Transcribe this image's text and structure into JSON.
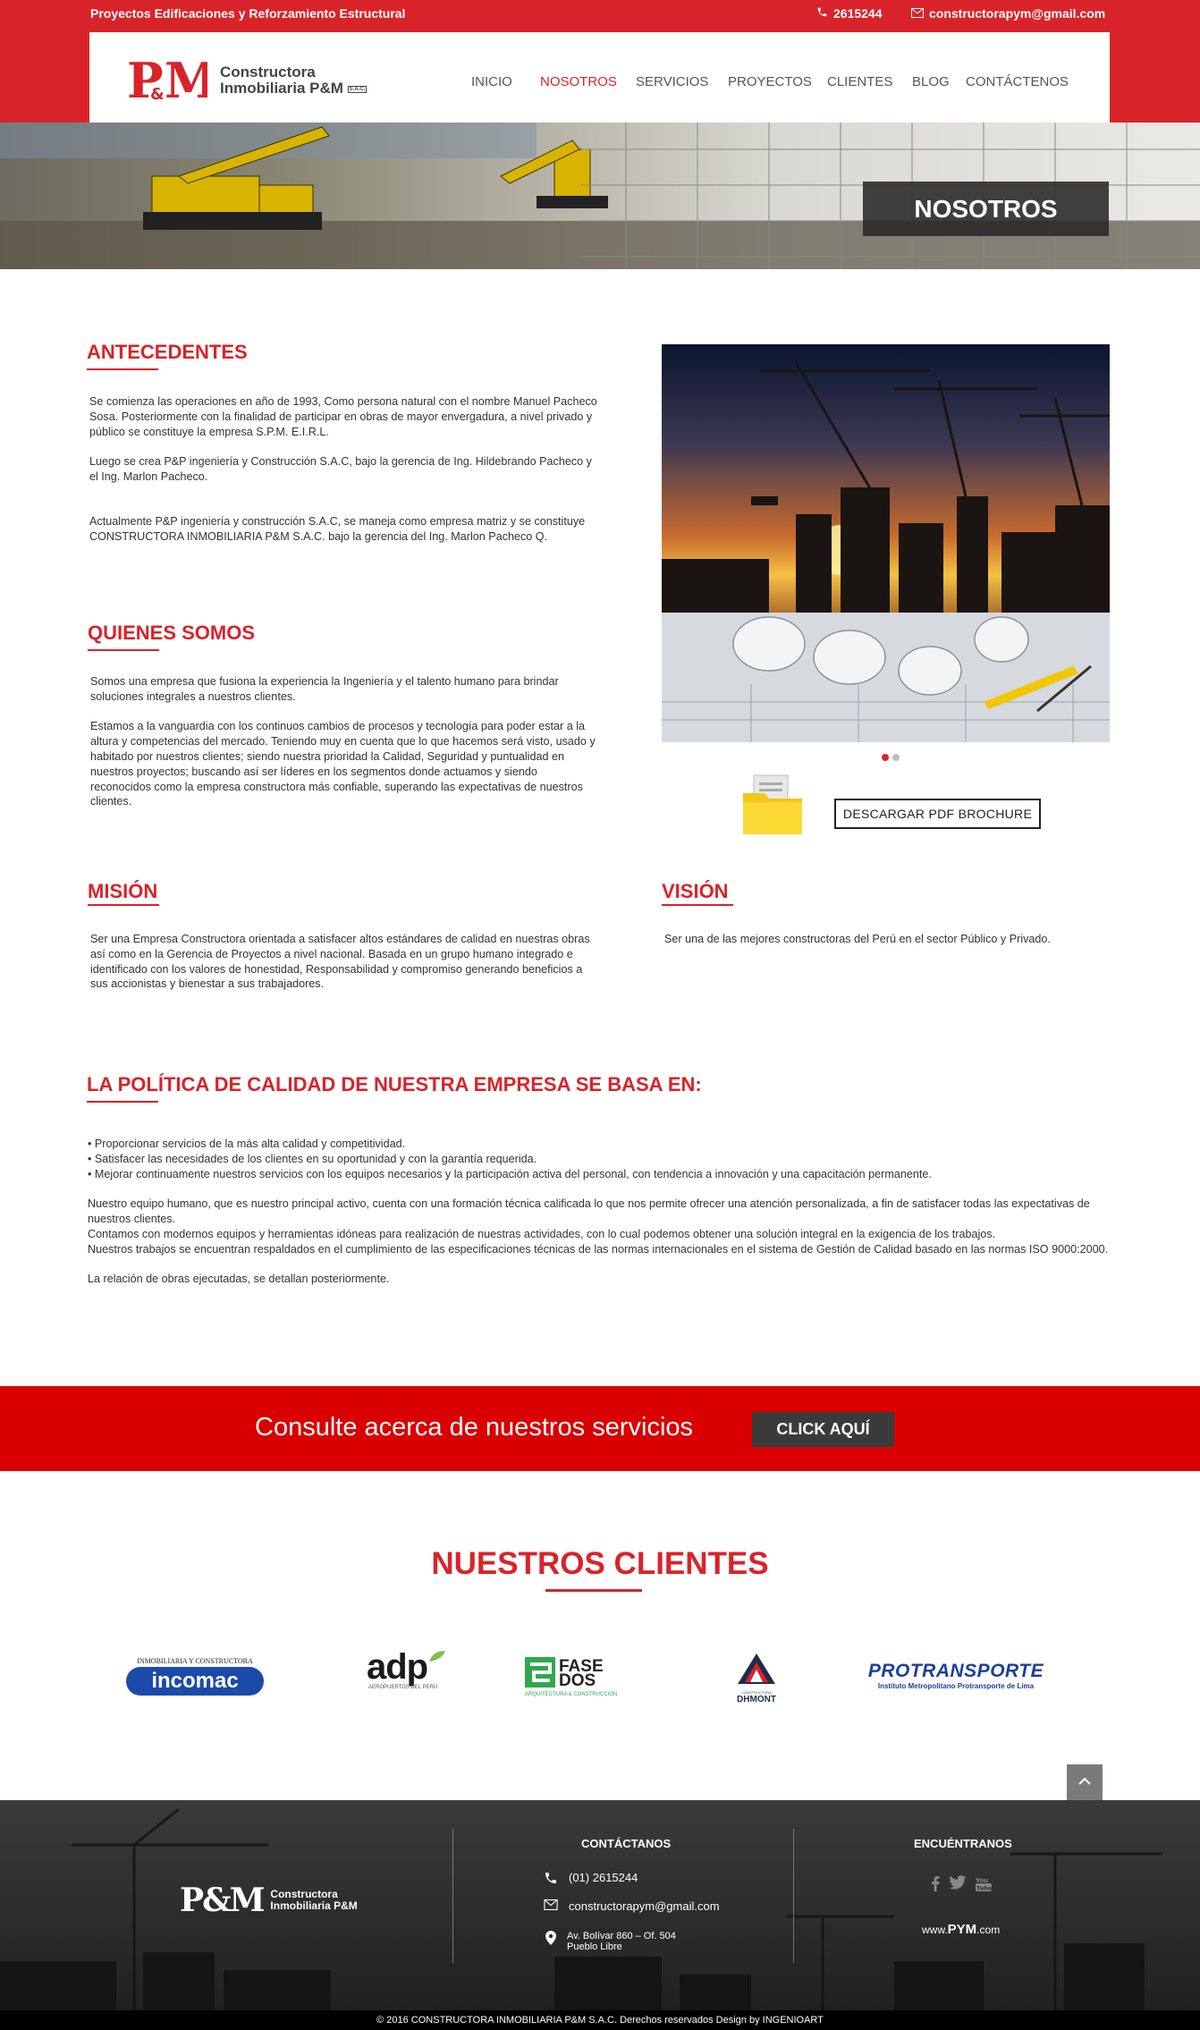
{
  "topbar": {
    "tagline": "Proyectos Edificaciones y Reforzamiento Estructural",
    "phone": "2615244",
    "email": "constructorapym@gmail.com"
  },
  "brand": {
    "mark": "P&M",
    "name_line1": "Constructora",
    "name_line2": "Inmobiliaria P&M",
    "suffix": "S.A.C."
  },
  "nav": {
    "items": [
      "INICIO",
      "NOSOTROS",
      "SERVICIOS",
      "PROYECTOS",
      "CLIENTES",
      "BLOG",
      "CONTÁCTENOS"
    ],
    "active": "NOSOTROS"
  },
  "hero": {
    "title": "NOSOTROS"
  },
  "antecedentes": {
    "title": "ANTECEDENTES",
    "p1": "Se comienza las operaciones en año de  1993, Como persona natural  con el nombre Manuel Pacheco Sosa. Posteriormente con la finalidad de participar en obras de mayor envergadura, a nivel privado y público se constituye la empresa S.P.M.  E.I.R.L.",
    "p2": "Luego se crea P&P ingeniería y Construcción S.A.C, bajo la gerencia de Ing. Hildebrando Pacheco y el Ing. Marlon Pacheco.",
    "p3": "Actualmente P&P ingeniería y construcción S.A.C, se maneja como empresa matriz  y se constituye CONSTRUCTORA INMOBILIARIA P&M S.A.C. bajo la gerencia del Ing. Marlon Pacheco Q."
  },
  "quienes": {
    "title": "QUIENES SOMOS",
    "p1": "Somos una empresa que fusiona la experiencia  la Ingeniería y el talento humano para brindar soluciones integrales a nuestros clientes.",
    "p2": "Estamos a la vanguardia con los continuos cambios de procesos y tecnología para poder estar a la altura y competencias del mercado. Teniendo muy en cuenta que lo que hacemos será visto, usado y habitado por nuestros clientes; siendo nuestra prioridad la Calidad, Seguridad y puntualidad en nuestros proyectos; buscando así ser líderes en los segmentos donde actuamos y siendo reconocidos como la empresa constructora más confiable, superando las expectativas de nuestros clientes."
  },
  "download": {
    "label": "DESCARGAR PDF BROCHURE"
  },
  "mision": {
    "title": "MISIÓN",
    "text": "Ser una Empresa Constructora orientada a satisfacer altos estándares de calidad en nuestras  obras así como en la Gerencia de Proyectos a nivel nacional. Basada en un grupo humano integrado e identificado con los valores de honestidad, Responsabilidad y compromiso generando beneficios a sus accionistas y bienestar a sus trabajadores."
  },
  "vision": {
    "title": "VISIÓN",
    "text": "Ser una de  las mejores  constructoras del Perú en el sector Público y Privado."
  },
  "politica": {
    "title": "LA POLÍTICA DE CALIDAD DE NUESTRA EMPRESA SE BASA EN:",
    "bullets": [
      "• Proporcionar servicios de la más alta calidad y competitividad.",
      "• Satisfacer las necesidades de los clientes en su oportunidad y con la garantía requerida.",
      "• Mejorar continuamente nuestros servicios con los equipos necesarios y la participación activa del personal, con tendencia a innovación y una capacitación permanente."
    ],
    "p1": "Nuestro equipo humano, que es nuestro principal activo, cuenta con una formación técnica calificada lo que nos permite ofrecer una atención personalizada, a fin de satisfacer todas las expectativas de nuestros clientes.",
    "p2": "Contamos con modernos equipos y herramientas idóneas para realización de nuestras actividades, con lo cual podemos obtener una solución integral en la exigencia de los trabajos.",
    "p3": "Nuestros trabajos se encuentran respaldados en el cumplimiento de las especificaciones técnicas de las normas internacionales en el sistema de Gestión de Calidad basado en las normas ISO 9000:2000.",
    "p4": "La relación de obras ejecutadas, se detallan posteriormente."
  },
  "cta": {
    "text": "Consulte acerca de nuestros servicios",
    "button": "CLICK AQUÍ"
  },
  "clients": {
    "title": "NUESTROS CLIENTES",
    "incomac_top": "INMOBILIARIA Y CONSTRUCTORA",
    "incomac": "incomac",
    "adp": "adp",
    "adp_sub": "AEROPUERTOS DEL PERÚ",
    "fase": "FASE",
    "dos": "DOS",
    "fase_sub": "ARQUITECTURA & CONSTRUCCIÓN",
    "dhmont": "DHMONT",
    "dhmont_top": "CONSTRUCTORA",
    "protransporte": "PROTRANSPORTE",
    "protransporte_sub": "Instituto Metropolitano Protransporte de Lima"
  },
  "footer": {
    "contact_title": "CONTÁCTANOS",
    "phone": "(01) 2615244",
    "email": "constructorapym@gmail.com",
    "address1": "Av. Bolívar 860 – Of. 504",
    "address2": "Pueblo Libre",
    "find_title": "ENCUÉNTRANOS",
    "site": "www.PYM.com",
    "site_prefix": "www.",
    "site_main": "PYM",
    "site_suffix": ".com",
    "copyright": "© 2016   CONSTRUCTORA INMOBILIARIA P&M S.A.C.   Derechos reservados Design by INGENIOART"
  },
  "colors": {
    "brand_red": "#d9232a",
    "cta_red": "#d90000",
    "footer_dark": "#2b2b2b"
  }
}
